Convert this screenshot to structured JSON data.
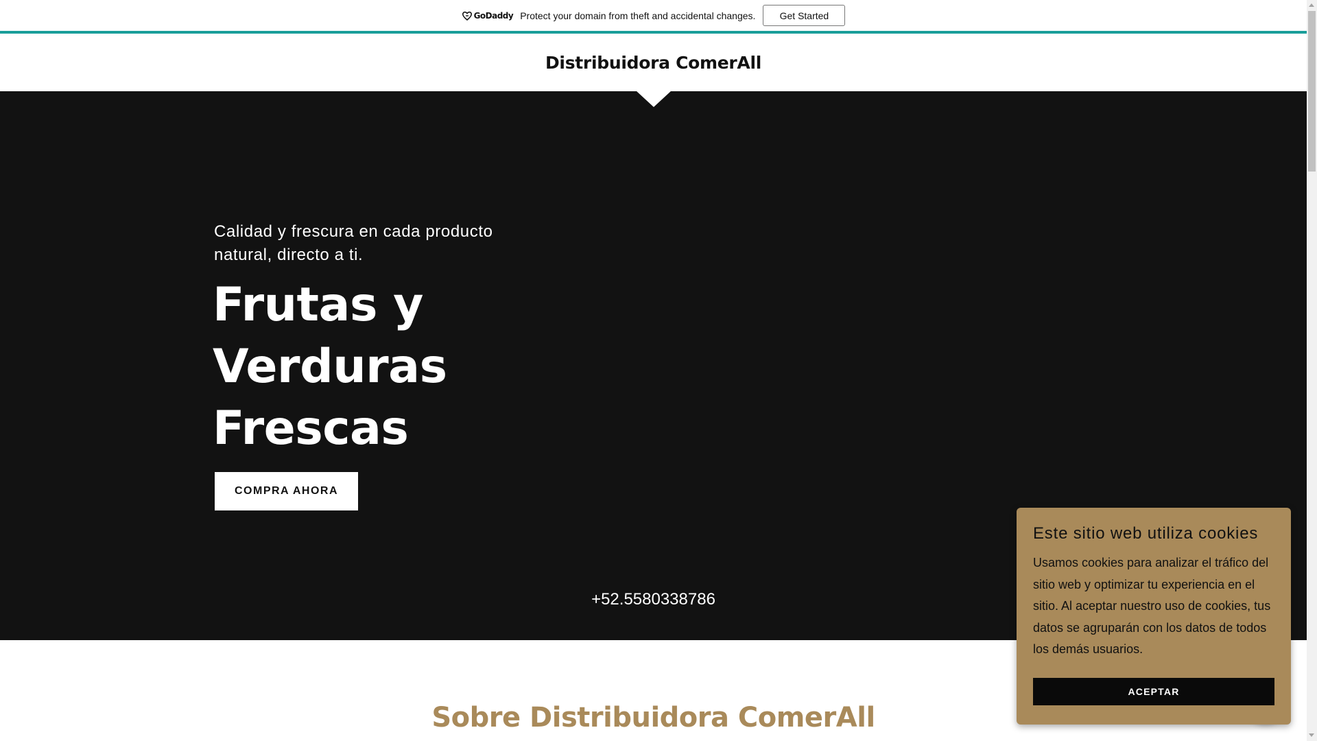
{
  "banner": {
    "logo_text": "GoDaddy",
    "message": "Protect your domain from theft and accidental changes.",
    "button_label": "Get Started",
    "accent_color": "#1a9e9a"
  },
  "header": {
    "site_title": "Distribuidora ComerAll"
  },
  "hero": {
    "tagline": "Calidad y frescura en cada producto natural, directo a ti.",
    "heading_lines": [
      "Frutas y",
      "Verduras",
      "Frescas"
    ],
    "cta_label": "COMPRA AHORA",
    "phone": "+52.5580338786",
    "background_color": "#121212"
  },
  "about": {
    "title": "Sobre Distribuidora ComerAll",
    "title_color": "#a98a5a"
  },
  "cookie_notice": {
    "title": "Este sitio web utiliza cookies",
    "text": "Usamos cookies para analizar el tráfico del sitio web y optimizar tu experiencia en el sitio. Al aceptar nuestro uso de cookies, tus datos se agruparán con los datos de todos los demás usuarios.",
    "button_label": "ACEPTAR",
    "background_color": "#a98a5a"
  },
  "icons": {
    "godaddy_logo": "godaddy-logo-icon",
    "header_arrow": "down-pointer-icon"
  }
}
